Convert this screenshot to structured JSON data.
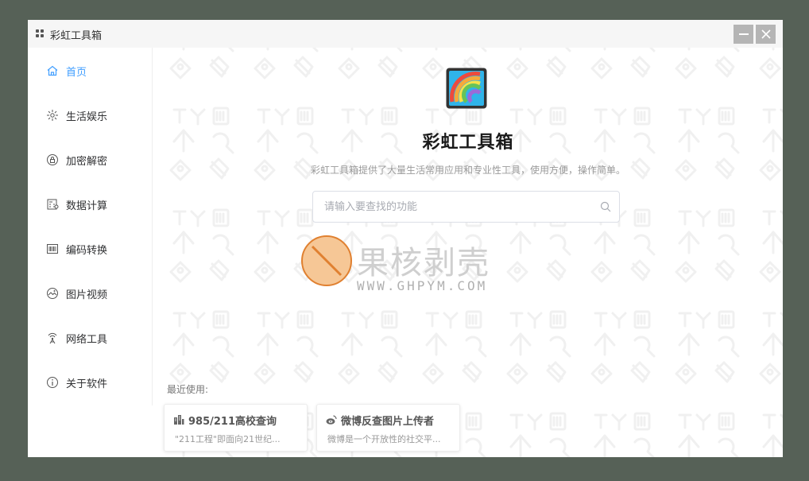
{
  "titlebar": {
    "title": "彩虹工具箱"
  },
  "sidebar": {
    "items": [
      {
        "label": "首页",
        "icon": "home-icon",
        "active": true
      },
      {
        "label": "生活娱乐",
        "icon": "sparkle-icon"
      },
      {
        "label": "加密解密",
        "icon": "lock-icon"
      },
      {
        "label": "数据计算",
        "icon": "calculator-icon"
      },
      {
        "label": "编码转换",
        "icon": "barcode-icon"
      },
      {
        "label": "图片视频",
        "icon": "image-icon"
      },
      {
        "label": "网络工具",
        "icon": "network-icon"
      },
      {
        "label": "关于软件",
        "icon": "info-icon"
      }
    ]
  },
  "hero": {
    "title": "彩虹工具箱",
    "subtitle": "彩虹工具箱提供了大量生活常用应用和专业性工具，使用方便，操作简单。"
  },
  "search": {
    "placeholder": "请输入要查找的功能"
  },
  "watermark": {
    "text": "果核剥壳",
    "url": "WWW.GHPYM.COM"
  },
  "recent": {
    "label": "最近使用:",
    "cards": [
      {
        "title": "985/211高校查询",
        "desc": "\"211工程\"即面向21世纪...",
        "icon": "building-icon"
      },
      {
        "title": "微博反查图片上传者",
        "desc": "微博是一个开放性的社交平...",
        "icon": "weibo-icon"
      }
    ]
  },
  "colors": {
    "accent": "#409eff",
    "desktop": "#566157"
  }
}
